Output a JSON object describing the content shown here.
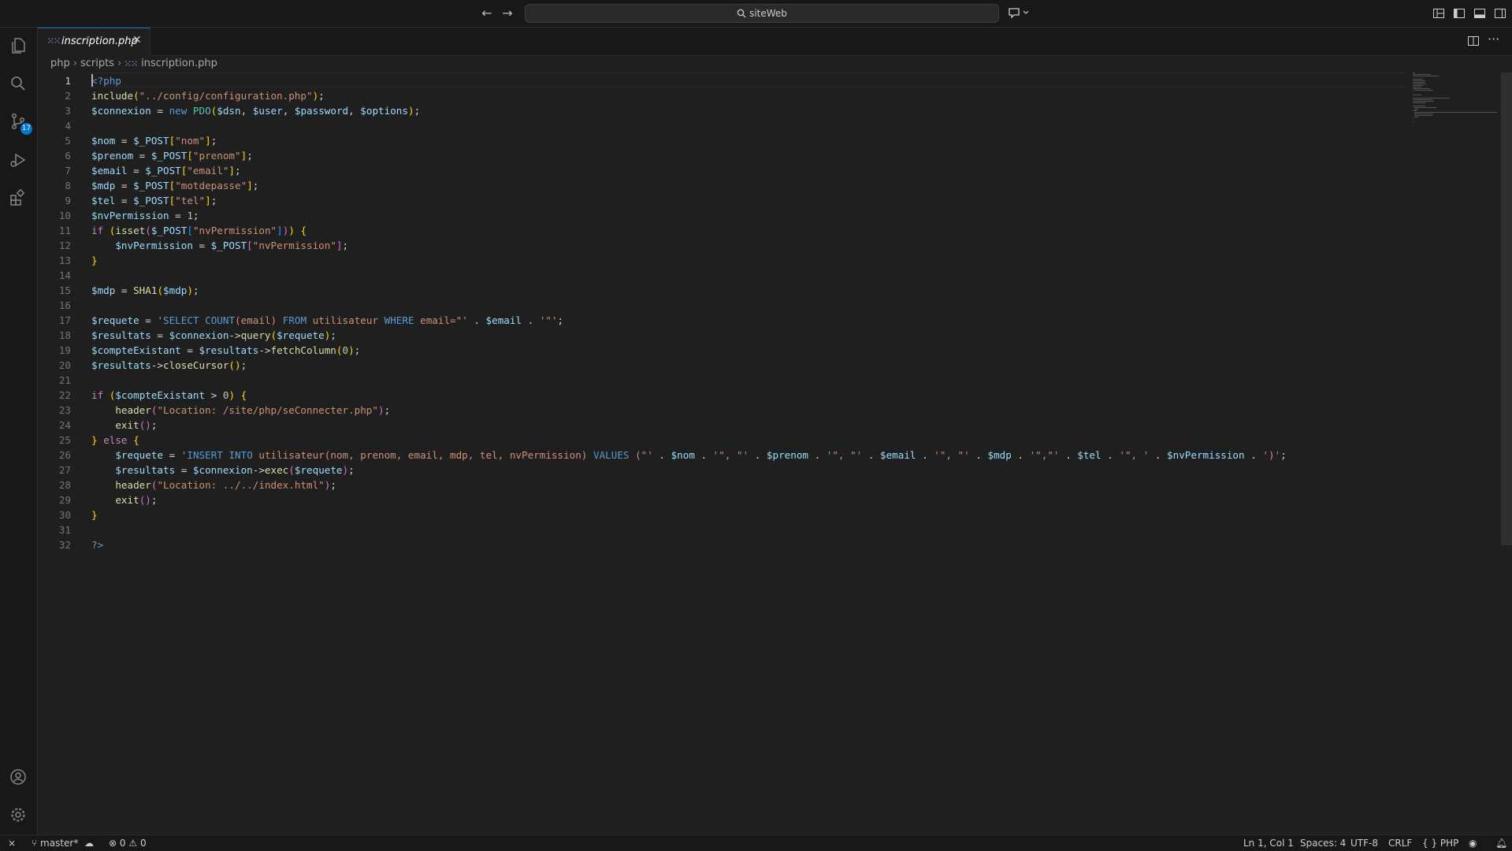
{
  "window": {
    "search_label": "siteWeb"
  },
  "tab": {
    "file_name": "inscription.php",
    "icon_glyph": "php-icon"
  },
  "breadcrumb": [
    "php",
    "scripts",
    "inscription.php"
  ],
  "scm_badge": "17",
  "editor": {
    "language": "php",
    "cursor_line": 1,
    "lines": [
      "<?php",
      "include(\"../config/configuration.php\");",
      "$connexion = new PDO($dsn, $user, $password, $options);",
      "",
      "$nom = $_POST[\"nom\"];",
      "$prenom = $_POST[\"prenom\"];",
      "$email = $_POST[\"email\"];",
      "$mdp = $_POST[\"motdepasse\"];",
      "$tel = $_POST[\"tel\"];",
      "$nvPermission = 1;",
      "if (isset($_POST[\"nvPermission\"])) {",
      "    $nvPermission = $_POST[\"nvPermission\"];",
      "}",
      "",
      "$mdp = SHA1($mdp);",
      "",
      "$requete = 'SELECT COUNT(email) FROM utilisateur WHERE email=\"' . $email . '\"';",
      "$resultats = $connexion->query($requete);",
      "$compteExistant = $resultats->fetchColumn(0);",
      "$resultats->closeCursor();",
      "",
      "if ($compteExistant > 0) {",
      "    header(\"Location: /site/php/seConnecter.php\");",
      "    exit();",
      "} else {",
      "    $requete = 'INSERT INTO utilisateur(nom, prenom, email, mdp, tel, nvPermission) VALUES (\"' . $nom . '\", \"' . $prenom . '\", \"' . $email . '\", \"' . $mdp . '\",\"' . $tel . '\", ' . $nvPermission . ')';",
      "    $resultats = $connexion->exec($requete);",
      "    header(\"Location: ../../index.html\");",
      "    exit();",
      "}",
      "",
      "?>"
    ]
  },
  "status": {
    "branch": "master*",
    "errors": "0",
    "warnings": "0",
    "position": "Ln 1, Col 1",
    "spaces": "Spaces: 4",
    "encoding": "UTF-8",
    "eol": "CRLF",
    "language": "PHP"
  },
  "colors": {
    "accent": "#0078d4",
    "background": "#1f1f1f",
    "chrome": "#181818"
  }
}
